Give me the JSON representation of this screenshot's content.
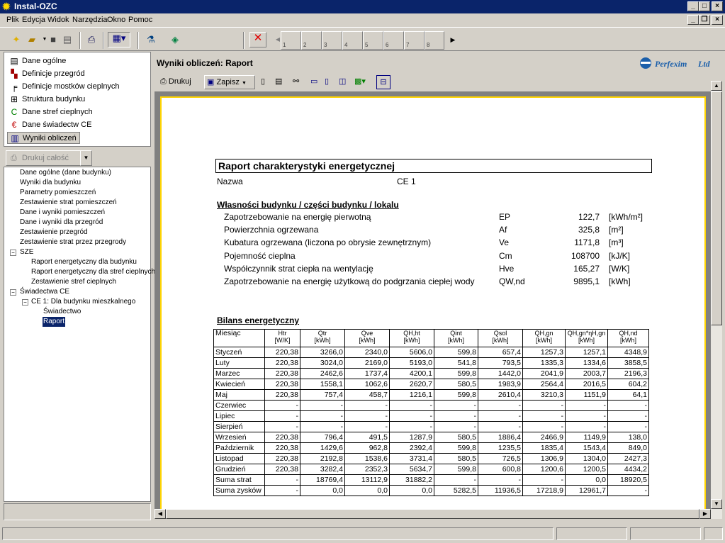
{
  "app": {
    "title": "Instal-OZC"
  },
  "menu": [
    "Plik",
    "Edycja",
    "Widok",
    "Narzędzia",
    "Okno",
    "Pomoc"
  ],
  "toolbar": {
    "pages": [
      "1",
      "2",
      "3",
      "4",
      "5",
      "6",
      "7",
      "8"
    ]
  },
  "nav": {
    "items": [
      {
        "label": "Dane ogólne",
        "icon": "document-icon"
      },
      {
        "label": "Definicje przegród",
        "icon": "wall-icon"
      },
      {
        "label": "Definicje mostków cieplnych",
        "icon": "bridge-icon"
      },
      {
        "label": "Struktura budynku",
        "icon": "structure-icon"
      },
      {
        "label": "Dane stref cieplnych",
        "icon": "zone-icon"
      },
      {
        "label": "Dane świadectw CE",
        "icon": "certificate-icon"
      },
      {
        "label": "Wyniki obliczeń",
        "icon": "results-icon"
      }
    ],
    "print_all": "Drukuj całość"
  },
  "tree": [
    {
      "label": "Dane ogólne (dane budynku)"
    },
    {
      "label": "Wyniki dla budynku"
    },
    {
      "label": "Parametry pomieszczeń"
    },
    {
      "label": "Zestawienie strat pomieszczeń"
    },
    {
      "label": "Dane i wyniki pomieszczeń"
    },
    {
      "label": "Dane i wyniki dla przegród"
    },
    {
      "label": "Zestawienie przegród"
    },
    {
      "label": "Zestawienie strat przez przegrody"
    },
    {
      "label": "SZE"
    },
    {
      "label": "Raport energetyczny dla budynku"
    },
    {
      "label": "Raport energetyczny dla stref cieplnych"
    },
    {
      "label": "Zestawienie stref cieplnych"
    },
    {
      "label": "Świadectwa CE"
    },
    {
      "label": "CE 1: Dla budynku mieszkalnego"
    },
    {
      "label": "Świadectwo"
    },
    {
      "label": "Raport"
    }
  ],
  "panel": {
    "title": "Wyniki obliczeń: Raport",
    "logo": "Perfexim Ltd"
  },
  "report_toolbar": {
    "print": "Drukuj",
    "save": "Zapisz"
  },
  "report": {
    "title": "Raport charakterystyki energetycznej",
    "name_label": "Nazwa",
    "name_value": "CE 1",
    "props_heading": "Własności budynku / części budynku / lokalu",
    "props": [
      {
        "label": "Zapotrzebowanie na energię pierwotną",
        "sym": "EP",
        "value": "122,7",
        "unit": "[kWh/m²]"
      },
      {
        "label": "Powierzchnia ogrzewana",
        "sym": "Af",
        "value": "325,8",
        "unit": "[m²]"
      },
      {
        "label": "Kubatura ogrzewana (liczona po obrysie zewnętrznym)",
        "sym": "Ve",
        "value": "1171,8",
        "unit": "[m³]"
      },
      {
        "label": "Pojemność cieplna",
        "sym": "Cm",
        "value": "108700",
        "unit": "[kJ/K]"
      },
      {
        "label": "Współczynnik strat ciepła na wentylację",
        "sym": "Hve",
        "value": "165,27",
        "unit": "[W/K]"
      },
      {
        "label": "Zapotrzebowanie na energię użytkową do podgrzania ciepłej wody",
        "sym": "QW,nd",
        "value": "9895,1",
        "unit": "[kWh]"
      }
    ],
    "balance_heading": "Bilans energetyczny",
    "balance_headers": [
      {
        "l1": "Miesiąc",
        "l2": ""
      },
      {
        "l1": "Htr",
        "l2": "[W/K]"
      },
      {
        "l1": "Qtr",
        "l2": "[kWh]"
      },
      {
        "l1": "Qve",
        "l2": "[kWh]"
      },
      {
        "l1": "QH,ht",
        "l2": "[kWh]"
      },
      {
        "l1": "Qint",
        "l2": "[kWh]"
      },
      {
        "l1": "Qsol",
        "l2": "[kWh]"
      },
      {
        "l1": "QH,gn",
        "l2": "[kWh]"
      },
      {
        "l1": "QH,gn*ηH,gn",
        "l2": "[kWh]"
      },
      {
        "l1": "QH,nd",
        "l2": "[kWh]"
      }
    ],
    "balance_rows": [
      [
        "Styczeń",
        "220,38",
        "3266,0",
        "2340,0",
        "5606,0",
        "599,8",
        "657,4",
        "1257,3",
        "1257,1",
        "4348,9"
      ],
      [
        "Luty",
        "220,38",
        "3024,0",
        "2169,0",
        "5193,0",
        "541,8",
        "793,5",
        "1335,3",
        "1334,6",
        "3858,5"
      ],
      [
        "Marzec",
        "220,38",
        "2462,6",
        "1737,4",
        "4200,1",
        "599,8",
        "1442,0",
        "2041,9",
        "2003,7",
        "2196,3"
      ],
      [
        "Kwiecień",
        "220,38",
        "1558,1",
        "1062,6",
        "2620,7",
        "580,5",
        "1983,9",
        "2564,4",
        "2016,5",
        "604,2"
      ],
      [
        "Maj",
        "220,38",
        "757,4",
        "458,7",
        "1216,1",
        "599,8",
        "2610,4",
        "3210,3",
        "1151,9",
        "64,1"
      ],
      [
        "Czerwiec",
        "-",
        "-",
        "-",
        "-",
        "-",
        "-",
        "-",
        "-",
        "-"
      ],
      [
        "Lipiec",
        "-",
        "-",
        "-",
        "-",
        "-",
        "-",
        "-",
        "-",
        "-"
      ],
      [
        "Sierpień",
        "-",
        "-",
        "-",
        "-",
        "-",
        "-",
        "-",
        "-",
        "-"
      ],
      [
        "Wrzesień",
        "220,38",
        "796,4",
        "491,5",
        "1287,9",
        "580,5",
        "1886,4",
        "2466,9",
        "1149,9",
        "138,0"
      ],
      [
        "Październik",
        "220,38",
        "1429,6",
        "962,8",
        "2392,4",
        "599,8",
        "1235,5",
        "1835,4",
        "1543,4",
        "849,0"
      ],
      [
        "Listopad",
        "220,38",
        "2192,8",
        "1538,6",
        "3731,4",
        "580,5",
        "726,5",
        "1306,9",
        "1304,0",
        "2427,3"
      ],
      [
        "Grudzień",
        "220,38",
        "3282,4",
        "2352,3",
        "5634,7",
        "599,8",
        "600,8",
        "1200,6",
        "1200,5",
        "4434,2"
      ],
      [
        "Suma strat",
        "-",
        "18769,4",
        "13112,9",
        "31882,2",
        "-",
        "-",
        "-",
        "0,0",
        "18920,5"
      ],
      [
        "Suma zysków",
        "-",
        "0,0",
        "0,0",
        "0,0",
        "5282,5",
        "11936,5",
        "17218,9",
        "12961,7",
        "-"
      ]
    ]
  }
}
